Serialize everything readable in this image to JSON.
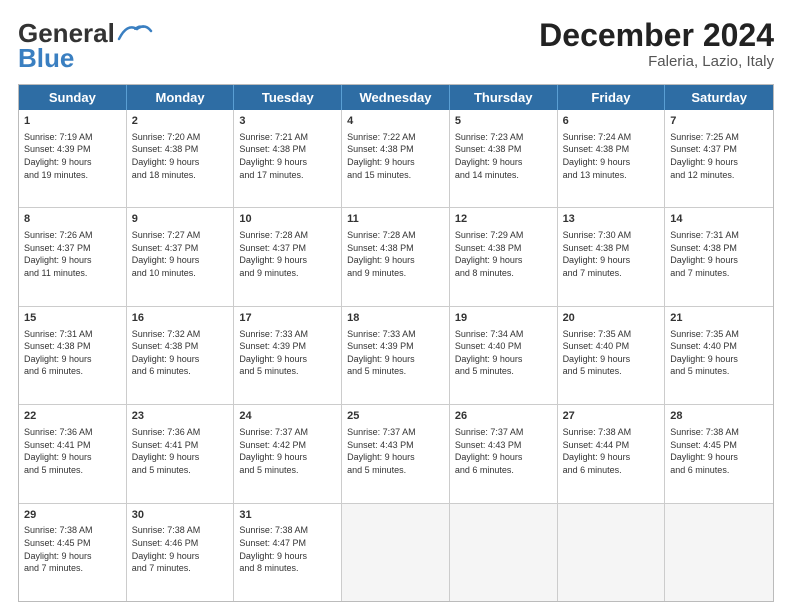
{
  "header": {
    "logo_line1": "General",
    "logo_line2": "Blue",
    "month": "December 2024",
    "location": "Faleria, Lazio, Italy"
  },
  "weekdays": [
    "Sunday",
    "Monday",
    "Tuesday",
    "Wednesday",
    "Thursday",
    "Friday",
    "Saturday"
  ],
  "weeks": [
    [
      {
        "day": "1",
        "lines": [
          "Sunrise: 7:19 AM",
          "Sunset: 4:39 PM",
          "Daylight: 9 hours",
          "and 19 minutes."
        ]
      },
      {
        "day": "2",
        "lines": [
          "Sunrise: 7:20 AM",
          "Sunset: 4:38 PM",
          "Daylight: 9 hours",
          "and 18 minutes."
        ]
      },
      {
        "day": "3",
        "lines": [
          "Sunrise: 7:21 AM",
          "Sunset: 4:38 PM",
          "Daylight: 9 hours",
          "and 17 minutes."
        ]
      },
      {
        "day": "4",
        "lines": [
          "Sunrise: 7:22 AM",
          "Sunset: 4:38 PM",
          "Daylight: 9 hours",
          "and 15 minutes."
        ]
      },
      {
        "day": "5",
        "lines": [
          "Sunrise: 7:23 AM",
          "Sunset: 4:38 PM",
          "Daylight: 9 hours",
          "and 14 minutes."
        ]
      },
      {
        "day": "6",
        "lines": [
          "Sunrise: 7:24 AM",
          "Sunset: 4:38 PM",
          "Daylight: 9 hours",
          "and 13 minutes."
        ]
      },
      {
        "day": "7",
        "lines": [
          "Sunrise: 7:25 AM",
          "Sunset: 4:37 PM",
          "Daylight: 9 hours",
          "and 12 minutes."
        ]
      }
    ],
    [
      {
        "day": "8",
        "lines": [
          "Sunrise: 7:26 AM",
          "Sunset: 4:37 PM",
          "Daylight: 9 hours",
          "and 11 minutes."
        ]
      },
      {
        "day": "9",
        "lines": [
          "Sunrise: 7:27 AM",
          "Sunset: 4:37 PM",
          "Daylight: 9 hours",
          "and 10 minutes."
        ]
      },
      {
        "day": "10",
        "lines": [
          "Sunrise: 7:28 AM",
          "Sunset: 4:37 PM",
          "Daylight: 9 hours",
          "and 9 minutes."
        ]
      },
      {
        "day": "11",
        "lines": [
          "Sunrise: 7:28 AM",
          "Sunset: 4:38 PM",
          "Daylight: 9 hours",
          "and 9 minutes."
        ]
      },
      {
        "day": "12",
        "lines": [
          "Sunrise: 7:29 AM",
          "Sunset: 4:38 PM",
          "Daylight: 9 hours",
          "and 8 minutes."
        ]
      },
      {
        "day": "13",
        "lines": [
          "Sunrise: 7:30 AM",
          "Sunset: 4:38 PM",
          "Daylight: 9 hours",
          "and 7 minutes."
        ]
      },
      {
        "day": "14",
        "lines": [
          "Sunrise: 7:31 AM",
          "Sunset: 4:38 PM",
          "Daylight: 9 hours",
          "and 7 minutes."
        ]
      }
    ],
    [
      {
        "day": "15",
        "lines": [
          "Sunrise: 7:31 AM",
          "Sunset: 4:38 PM",
          "Daylight: 9 hours",
          "and 6 minutes."
        ]
      },
      {
        "day": "16",
        "lines": [
          "Sunrise: 7:32 AM",
          "Sunset: 4:38 PM",
          "Daylight: 9 hours",
          "and 6 minutes."
        ]
      },
      {
        "day": "17",
        "lines": [
          "Sunrise: 7:33 AM",
          "Sunset: 4:39 PM",
          "Daylight: 9 hours",
          "and 5 minutes."
        ]
      },
      {
        "day": "18",
        "lines": [
          "Sunrise: 7:33 AM",
          "Sunset: 4:39 PM",
          "Daylight: 9 hours",
          "and 5 minutes."
        ]
      },
      {
        "day": "19",
        "lines": [
          "Sunrise: 7:34 AM",
          "Sunset: 4:40 PM",
          "Daylight: 9 hours",
          "and 5 minutes."
        ]
      },
      {
        "day": "20",
        "lines": [
          "Sunrise: 7:35 AM",
          "Sunset: 4:40 PM",
          "Daylight: 9 hours",
          "and 5 minutes."
        ]
      },
      {
        "day": "21",
        "lines": [
          "Sunrise: 7:35 AM",
          "Sunset: 4:40 PM",
          "Daylight: 9 hours",
          "and 5 minutes."
        ]
      }
    ],
    [
      {
        "day": "22",
        "lines": [
          "Sunrise: 7:36 AM",
          "Sunset: 4:41 PM",
          "Daylight: 9 hours",
          "and 5 minutes."
        ]
      },
      {
        "day": "23",
        "lines": [
          "Sunrise: 7:36 AM",
          "Sunset: 4:41 PM",
          "Daylight: 9 hours",
          "and 5 minutes."
        ]
      },
      {
        "day": "24",
        "lines": [
          "Sunrise: 7:37 AM",
          "Sunset: 4:42 PM",
          "Daylight: 9 hours",
          "and 5 minutes."
        ]
      },
      {
        "day": "25",
        "lines": [
          "Sunrise: 7:37 AM",
          "Sunset: 4:43 PM",
          "Daylight: 9 hours",
          "and 5 minutes."
        ]
      },
      {
        "day": "26",
        "lines": [
          "Sunrise: 7:37 AM",
          "Sunset: 4:43 PM",
          "Daylight: 9 hours",
          "and 6 minutes."
        ]
      },
      {
        "day": "27",
        "lines": [
          "Sunrise: 7:38 AM",
          "Sunset: 4:44 PM",
          "Daylight: 9 hours",
          "and 6 minutes."
        ]
      },
      {
        "day": "28",
        "lines": [
          "Sunrise: 7:38 AM",
          "Sunset: 4:45 PM",
          "Daylight: 9 hours",
          "and 6 minutes."
        ]
      }
    ],
    [
      {
        "day": "29",
        "lines": [
          "Sunrise: 7:38 AM",
          "Sunset: 4:45 PM",
          "Daylight: 9 hours",
          "and 7 minutes."
        ]
      },
      {
        "day": "30",
        "lines": [
          "Sunrise: 7:38 AM",
          "Sunset: 4:46 PM",
          "Daylight: 9 hours",
          "and 7 minutes."
        ]
      },
      {
        "day": "31",
        "lines": [
          "Sunrise: 7:38 AM",
          "Sunset: 4:47 PM",
          "Daylight: 9 hours",
          "and 8 minutes."
        ]
      },
      {
        "day": "",
        "lines": []
      },
      {
        "day": "",
        "lines": []
      },
      {
        "day": "",
        "lines": []
      },
      {
        "day": "",
        "lines": []
      }
    ]
  ]
}
